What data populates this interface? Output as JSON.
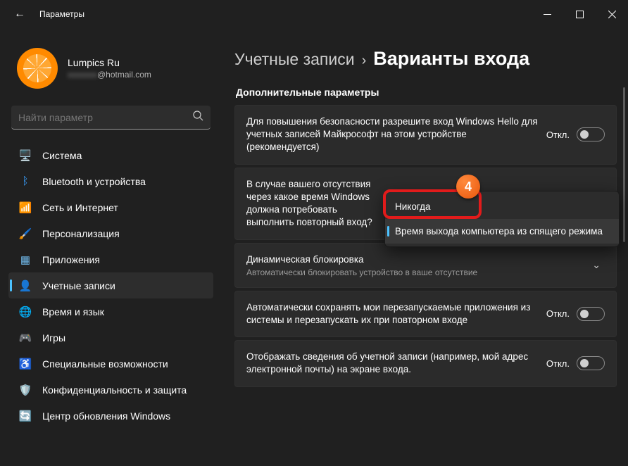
{
  "window": {
    "title": "Параметры",
    "back_icon": "←"
  },
  "profile": {
    "name": "Lumpics Ru",
    "email_suffix": "@hotmail.com"
  },
  "search": {
    "placeholder": "Найти параметр"
  },
  "nav": {
    "items": [
      {
        "label": "Система",
        "icon": "🖥️",
        "color": "#3aa0ff"
      },
      {
        "label": "Bluetooth и устройства",
        "icon": "ᛒ",
        "color": "#3aa0ff"
      },
      {
        "label": "Сеть и Интернет",
        "icon": "📶",
        "color": "#45c1d9"
      },
      {
        "label": "Персонализация",
        "icon": "🖌️",
        "color": "#d17a3a"
      },
      {
        "label": "Приложения",
        "icon": "▦",
        "color": "#6fb7e8"
      },
      {
        "label": "Учетные записи",
        "icon": "👤",
        "color": "#ff985e"
      },
      {
        "label": "Время и язык",
        "icon": "🌐",
        "color": "#6fc0c6"
      },
      {
        "label": "Игры",
        "icon": "🎮",
        "color": "#9a9a9a"
      },
      {
        "label": "Специальные возможности",
        "icon": "♿",
        "color": "#6aa0d8"
      },
      {
        "label": "Конфиденциальность и защита",
        "icon": "🛡️",
        "color": "#5b8bb9"
      },
      {
        "label": "Центр обновления Windows",
        "icon": "🔄",
        "color": "#ff985e"
      }
    ],
    "active_index": 5
  },
  "breadcrumb": {
    "parent": "Учетные записи",
    "sep": "›",
    "current": "Варианты входа"
  },
  "section_title": "Дополнительные параметры",
  "toggle_off_label": "Откл.",
  "cards": [
    {
      "title": "Для повышения безопасности разрешите вход Windows Hello для учетных записей Майкрософт на этом устройстве (рекомендуется)",
      "control": "toggle"
    },
    {
      "title": "В случае вашего отсутствия через какое время Windows должна потребовать выполнить повторный вход?",
      "control": "dropdown"
    },
    {
      "title": "Динамическая блокировка",
      "sub": "Автоматически блокировать устройство в ваше отсутствие",
      "control": "expand"
    },
    {
      "title": "Автоматически сохранять мои перезапускаемые приложения из системы и перезапускать их при повторном входе",
      "control": "toggle"
    },
    {
      "title": "Отображать сведения об учетной записи (например, мой адрес электронной почты) на экране входа.",
      "control": "toggle"
    }
  ],
  "flyout": {
    "items": [
      {
        "label": "Никогда",
        "selected": false
      },
      {
        "label": "Время выхода компьютера из спящего режима",
        "selected": true
      }
    ]
  },
  "annotation": {
    "badge": "4"
  }
}
